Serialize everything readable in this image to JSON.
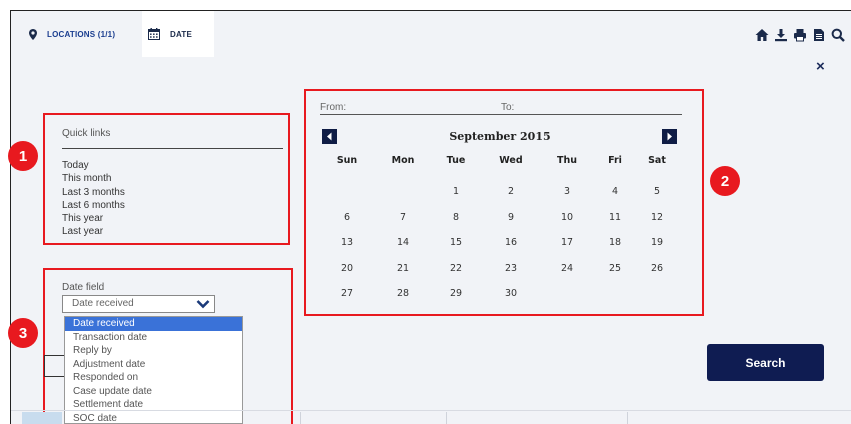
{
  "tabs": {
    "locations": "LOCATIONS (1/1)",
    "date": "DATE"
  },
  "toolbar": {
    "icons": [
      "home-icon",
      "download-icon",
      "print-icon",
      "document-icon",
      "search-icon"
    ]
  },
  "close_label": "×",
  "quick_links": {
    "title": "Quick links",
    "items": [
      "Today",
      "This month",
      "Last 3 months",
      "Last 6 months",
      "This year",
      "Last year"
    ]
  },
  "calendar": {
    "from_label": "From:",
    "to_label": "To:",
    "month_title": "September 2015",
    "weekdays": [
      "Sun",
      "Mon",
      "Tue",
      "Wed",
      "Thu",
      "Fri",
      "Sat"
    ],
    "weeks": [
      [
        "",
        "",
        "1",
        "2",
        "3",
        "4",
        "5"
      ],
      [
        "6",
        "7",
        "8",
        "9",
        "10",
        "11",
        "12"
      ],
      [
        "13",
        "14",
        "15",
        "16",
        "17",
        "18",
        "19"
      ],
      [
        "20",
        "21",
        "22",
        "23",
        "24",
        "25",
        "26"
      ],
      [
        "27",
        "28",
        "29",
        "30",
        "",
        "",
        ""
      ]
    ]
  },
  "date_field": {
    "label": "Date field",
    "selected": "Date received",
    "options": [
      "Date received",
      "Transaction date",
      "Reply by",
      "Adjustment date",
      "Responded on",
      "Case update date",
      "Settlement date",
      "SOC date"
    ]
  },
  "search_button": "Search",
  "badges": [
    "1",
    "2",
    "3"
  ],
  "colors": {
    "accent_red": "#e8191f",
    "navy": "#0f1c52",
    "selection_blue": "#3a72d8",
    "panel_bg": "#f1f3f7"
  }
}
